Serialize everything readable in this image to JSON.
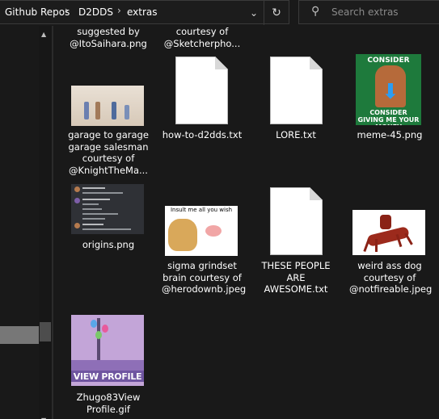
{
  "breadcrumb": {
    "items": [
      "Github Repos",
      "D2DDS",
      "extras"
    ],
    "separator": "›"
  },
  "toolbar": {
    "dropdown_icon": "chevron-down-icon",
    "refresh_icon": "refresh-icon"
  },
  "search": {
    "placeholder": "Search extras",
    "icon": "search-icon"
  },
  "files": {
    "partial_top": [
      {
        "label": "suggested by\n@ItoSaihara.png"
      },
      {
        "label": "courtesy of\n@Sketcherpho..."
      }
    ],
    "items": [
      {
        "label": "garage to garage garage salesman courtesy of @KnightTheMa...",
        "kind": "image"
      },
      {
        "label": "how-to-d2dds.txt",
        "kind": "text"
      },
      {
        "label": "LORE.txt",
        "kind": "text"
      },
      {
        "label": "meme-45.png",
        "kind": "image",
        "thumb_top": "CONSIDER",
        "thumb_bottom": "CONSIDER GIVING ME YOUR MONEY"
      },
      {
        "label": "origins.png",
        "kind": "image"
      },
      {
        "label": "sigma grindset brain courtesy of @herodownb.jpeg",
        "kind": "image",
        "thumb_caption": "Insult me all you wish"
      },
      {
        "label": "THESE PEOPLE ARE AWESOME.txt",
        "kind": "text"
      },
      {
        "label": "weird ass dog courtesy of @notfireable.jpeg",
        "kind": "image"
      },
      {
        "label": "Zhugo83ViewProfile.gif",
        "kind": "image",
        "thumb_text": "VIEW PROFILE"
      }
    ]
  },
  "colors": {
    "background": "#191919",
    "border": "#3a3a3a",
    "selection": "#777777",
    "text": "#ffffff",
    "placeholder": "#8a8a8a"
  }
}
